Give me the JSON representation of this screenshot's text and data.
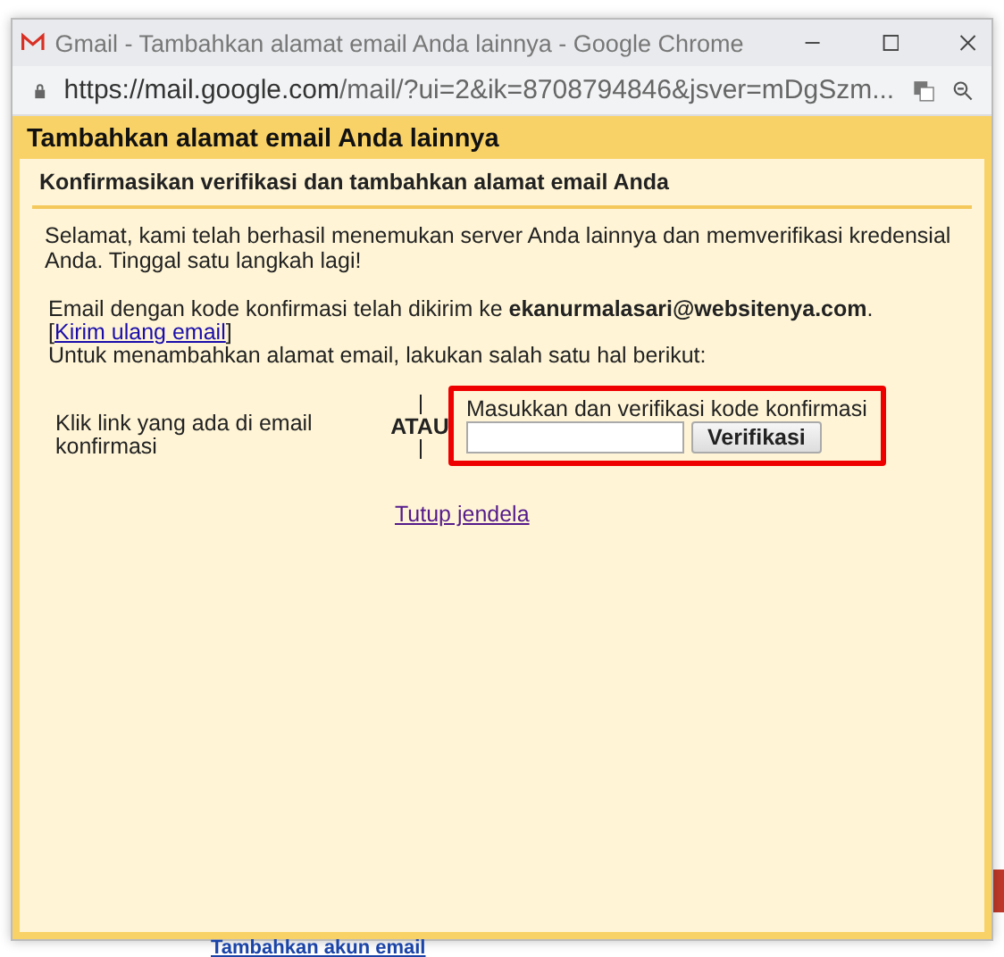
{
  "window": {
    "title": "Gmail - Tambahkan alamat email Anda lainnya - Google Chrome"
  },
  "address_bar": {
    "url_host": "https://mail.google.com",
    "url_path": "/mail/?ui=2&ik=8708794846&jsver=mDgSzm..."
  },
  "dialog": {
    "title": "Tambahkan alamat email Anda lainnya",
    "subtitle": "Konfirmasikan verifikasi dan tambahkan alamat email Anda",
    "intro": "Selamat, kami telah berhasil menemukan server Anda lainnya dan memverifikasi kredensial Anda. Tinggal satu langkah lagi!",
    "sent_notice": "Email dengan kode konfirmasi telah dikirim ke **ekanurmalasari@websitenya.com**.",
    "bracket_open": "[",
    "resend_link": "Kirim ulang email",
    "bracket_close": "]",
    "instruction": "Untuk menambahkan alamat email, lakukan salah satu hal berikut:",
    "option_link_text": "Klik link yang ada di email konfirmasi",
    "separator": "ATAU",
    "code_label": "Masukkan dan verifikasi kode konfirmasi",
    "verify_button": "Verifikasi",
    "close_link": "Tutup jendela"
  },
  "background": {
    "link": "Tambahkan akun email"
  }
}
